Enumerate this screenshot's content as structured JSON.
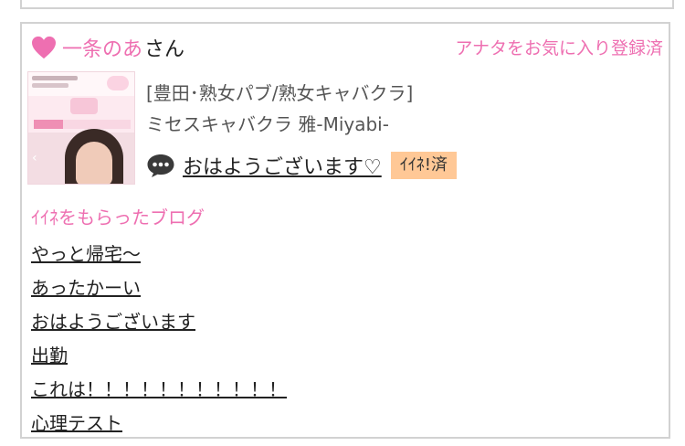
{
  "profile": {
    "user_name": "一条のあ",
    "honorific": "さん",
    "favorite_status": "アナタをお気に入り登録済"
  },
  "shop": {
    "category": "[豊田･熟女パブ/熟女キャバクラ]",
    "name": "ミセスキャバクラ 雅-Miyabi-"
  },
  "post": {
    "title": "おはようございます♡",
    "like_badge": "ｲｲﾈ!済"
  },
  "blogs": {
    "heading": "ｲｲﾈをもらったブログ",
    "items": [
      "やっと帰宅〜",
      "あったかーい",
      "おはようございます",
      "出勤",
      "これは！！！！！！！！！！！",
      "心理テスト"
    ]
  },
  "colors": {
    "accent_pink": "#ee6fb1",
    "badge_orange": "#ffc896",
    "border_gray": "#d2d2d2"
  },
  "icons": {
    "heart": "heart-icon",
    "comment": "speech-bubble-icon"
  }
}
